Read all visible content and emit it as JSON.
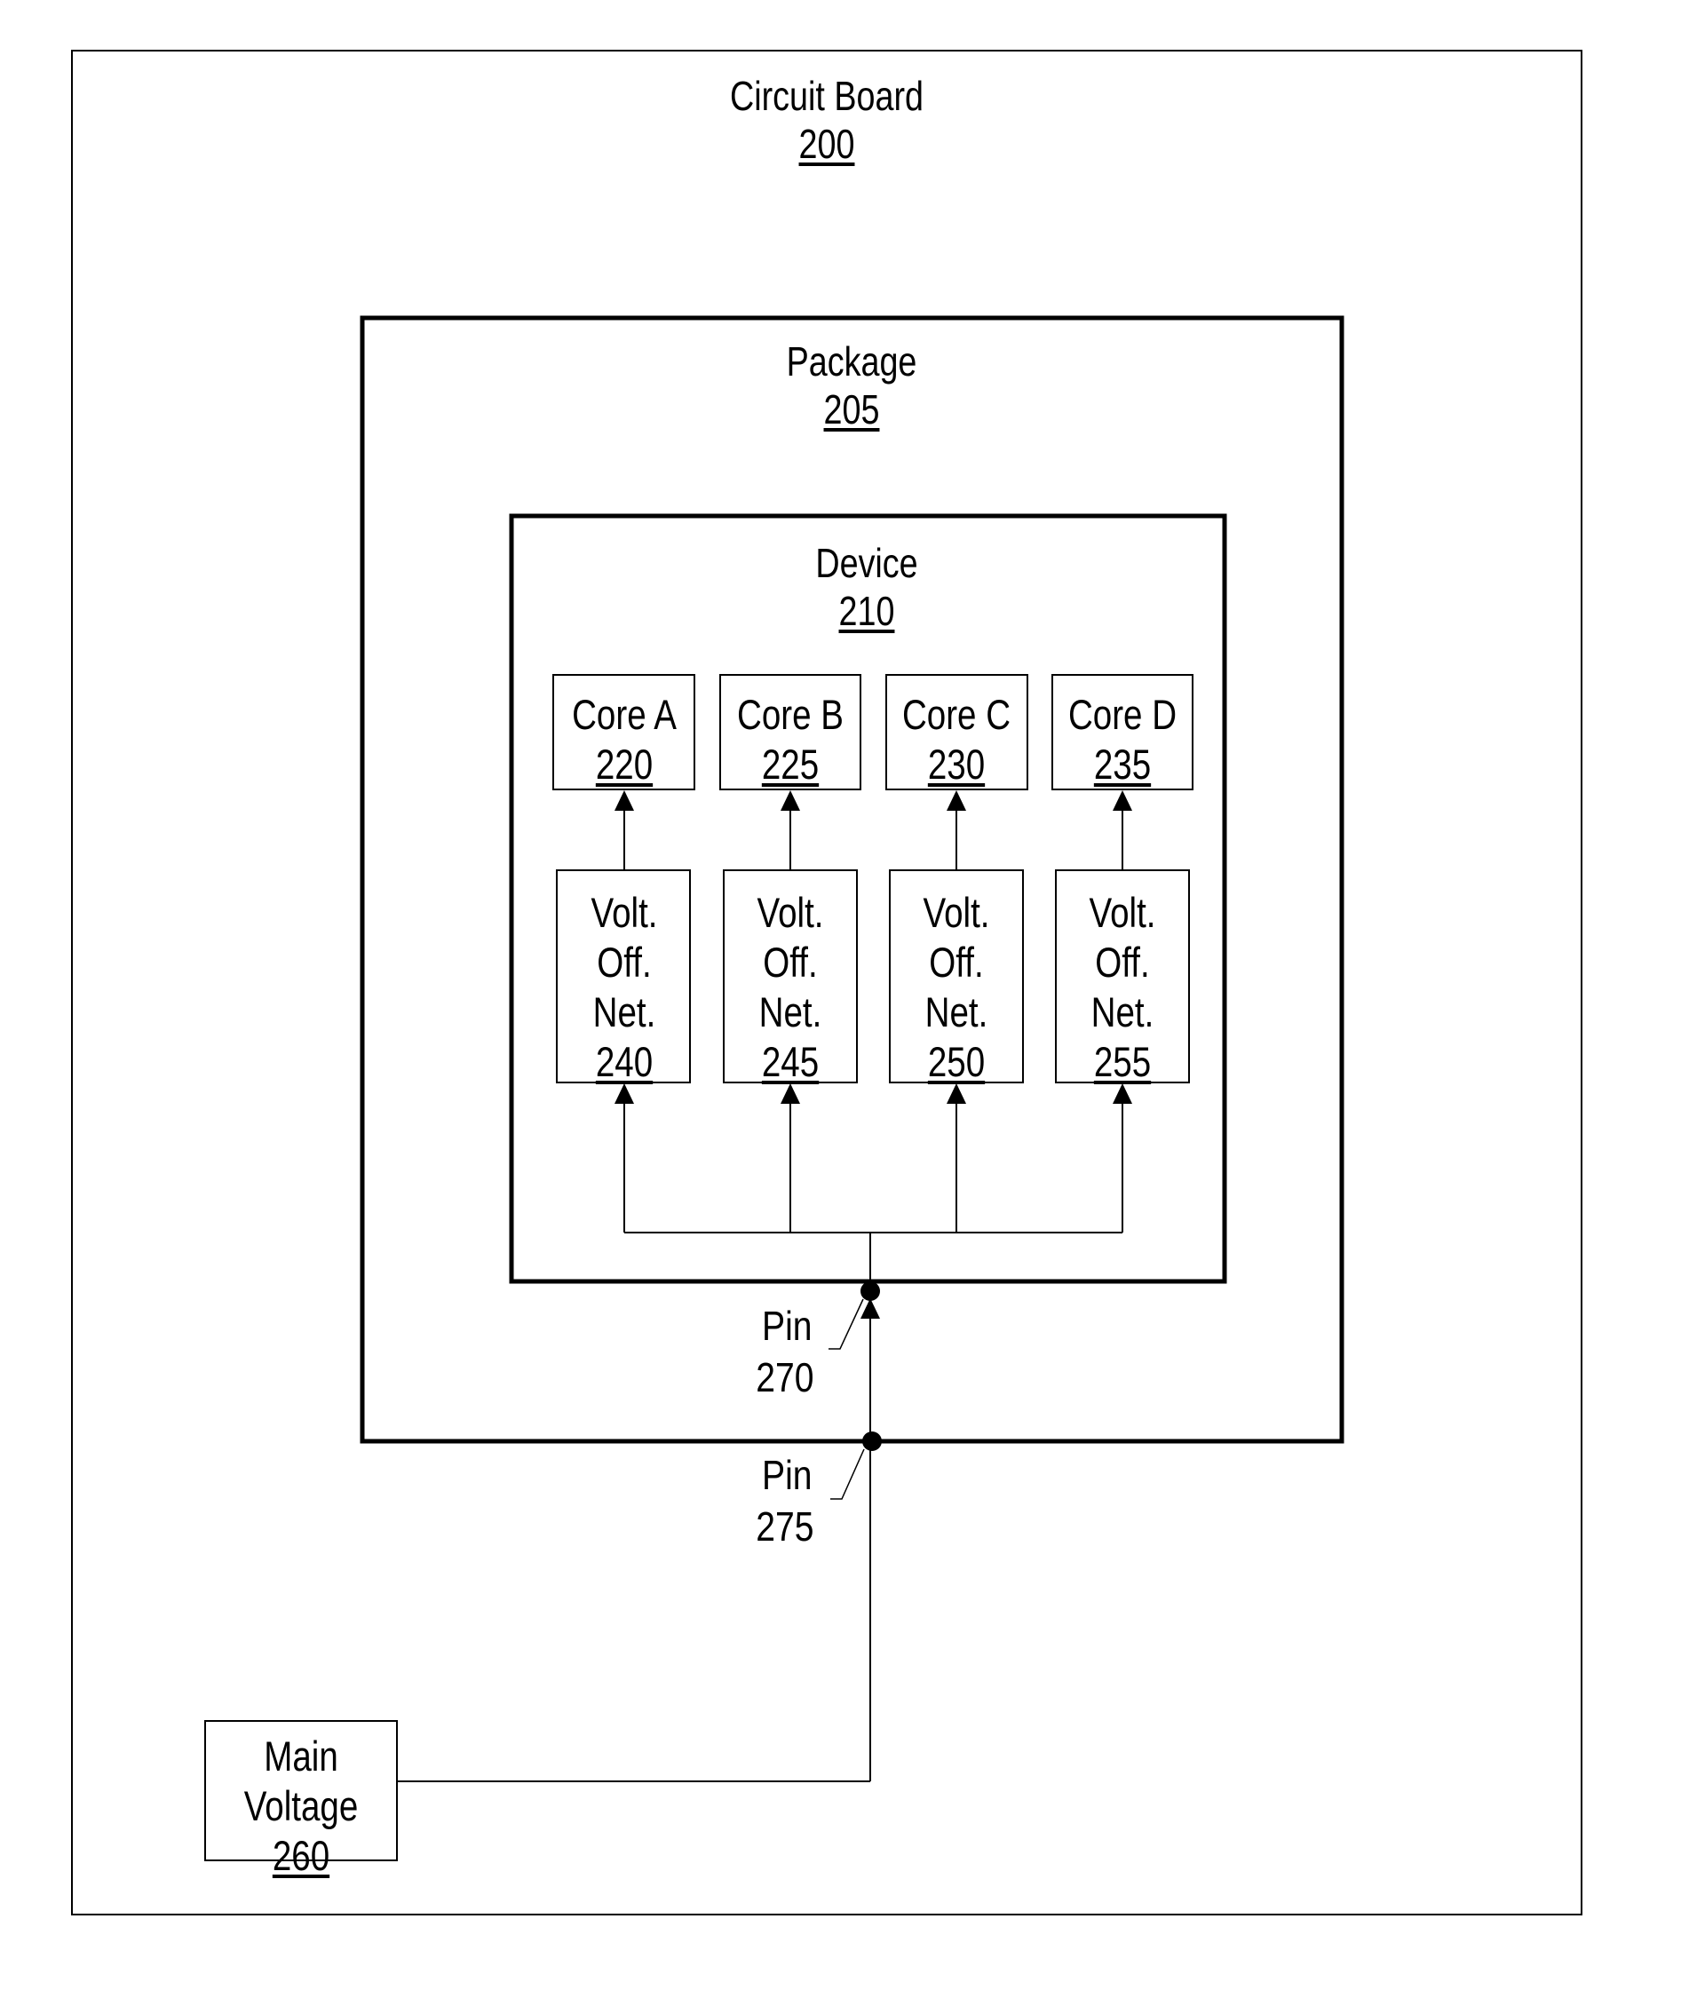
{
  "diagram": {
    "board": {
      "title": "Circuit Board",
      "ref": "200"
    },
    "package": {
      "title": "Package",
      "ref": "205"
    },
    "device": {
      "title": "Device",
      "ref": "210"
    },
    "cores": [
      {
        "title": "Core A",
        "ref": "220"
      },
      {
        "title": "Core B",
        "ref": "225"
      },
      {
        "title": "Core C",
        "ref": "230"
      },
      {
        "title": "Core D",
        "ref": "235"
      }
    ],
    "voltage_offset_networks": [
      {
        "lines": [
          "Volt.",
          "Off.",
          "Net."
        ],
        "ref": "240"
      },
      {
        "lines": [
          "Volt.",
          "Off.",
          "Net."
        ],
        "ref": "245"
      },
      {
        "lines": [
          "Volt.",
          "Off.",
          "Net."
        ],
        "ref": "250"
      },
      {
        "lines": [
          "Volt.",
          "Off.",
          "Net."
        ],
        "ref": "255"
      }
    ],
    "pins": [
      {
        "label": "Pin",
        "ref": "270"
      },
      {
        "label": "Pin",
        "ref": "275"
      }
    ],
    "main_voltage": {
      "lines": [
        "Main",
        "Voltage"
      ],
      "ref": "260"
    },
    "connections": [
      "Main Voltage 260 -> Pin 275",
      "Pin 275 -> Pin 270",
      "Pin 270 -> Volt. Off. Net. 240",
      "Pin 270 -> Volt. Off. Net. 245",
      "Pin 270 -> Volt. Off. Net. 250",
      "Pin 270 -> Volt. Off. Net. 255",
      "Volt. Off. Net. 240 -> Core A 220",
      "Volt. Off. Net. 245 -> Core B 225",
      "Volt. Off. Net. 250 -> Core C 230",
      "Volt. Off. Net. 255 -> Core D 235"
    ]
  }
}
